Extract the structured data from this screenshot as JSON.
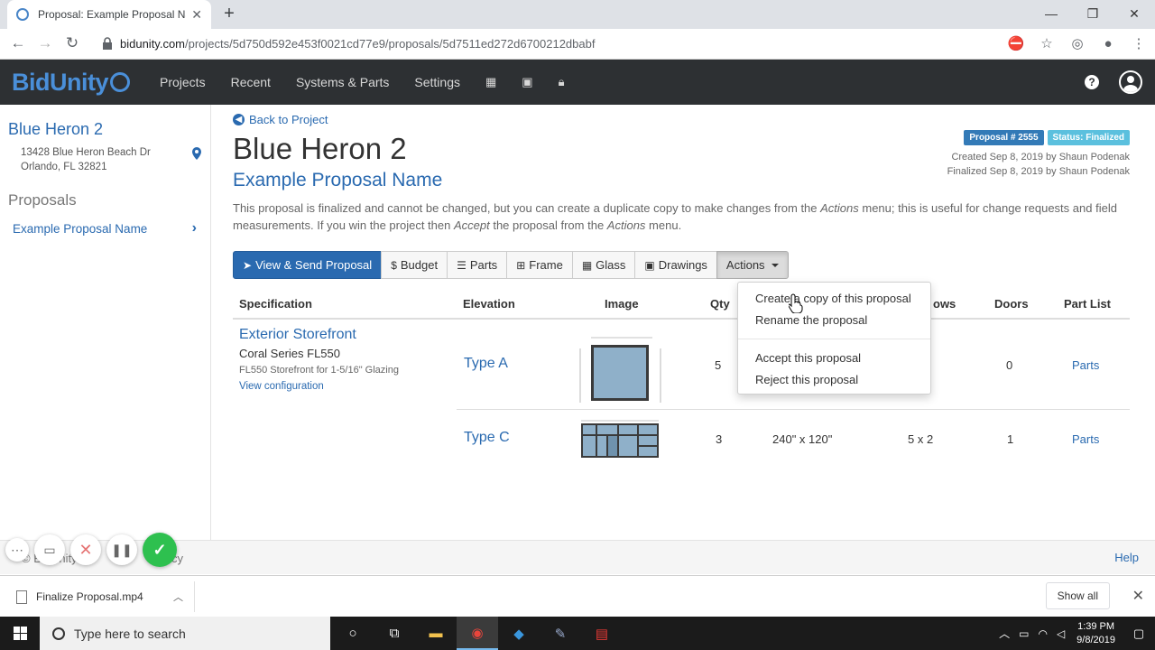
{
  "browser": {
    "tab_title": "Proposal: Example Proposal Nam",
    "url_host": "bidunity.com",
    "url_path": "/projects/5d750d592e453f0021cd77e9/proposals/5d7511ed272d6700212dbabf"
  },
  "navbar": {
    "logo": "BidUnity",
    "links": [
      "Projects",
      "Recent",
      "Systems & Parts",
      "Settings"
    ]
  },
  "sidebar": {
    "project_name": "Blue Heron 2",
    "address_line1": "13428 Blue Heron Beach Dr",
    "address_line2": "Orlando, FL 32821",
    "section_title": "Proposals",
    "active_proposal": "Example Proposal Name"
  },
  "main": {
    "back_link": "Back to Project",
    "title": "Blue Heron 2",
    "subtitle": "Example Proposal Name",
    "badge_number": "Proposal # 2555",
    "badge_status": "Status: Finalized",
    "created": "Created Sep 8, 2019 by Shaun Podenak",
    "finalized": "Finalized Sep 8, 2019 by Shaun Podenak",
    "info_1": "This proposal is finalized and cannot be changed, but you can create a duplicate copy to make changes from the ",
    "info_actions_1": "Actions",
    "info_2": " menu; this is useful for change requests and field measurements. If you win the project then ",
    "info_accept": "Accept",
    "info_3": " the proposal from the ",
    "info_actions_2": "Actions",
    "info_4": " menu."
  },
  "toolbar": {
    "view_send": "View & Send Proposal",
    "budget": "Budget",
    "parts": "Parts",
    "frame": "Frame",
    "glass": "Glass",
    "drawings": "Drawings",
    "actions": "Actions"
  },
  "table": {
    "headers": {
      "specification": "Specification",
      "elevation": "Elevation",
      "image": "Image",
      "qty": "Qty",
      "rows": "ows",
      "doors": "Doors",
      "part_list": "Part List"
    },
    "spec": {
      "title": "Exterior Storefront",
      "series": "Coral Series FL550",
      "desc": "FL550 Storefront for 1-5/16\" Glazing",
      "link": "View configuration"
    },
    "rows": [
      {
        "elevation": "Type A",
        "qty": "5",
        "size": "",
        "grid": "",
        "doors": "0",
        "part_list": "Parts"
      },
      {
        "elevation": "Type C",
        "qty": "3",
        "size": "240\" x 120\"",
        "grid": "5 x 2",
        "doors": "1",
        "part_list": "Parts"
      }
    ]
  },
  "actions_menu": {
    "items": [
      "Create a copy of this proposal",
      "Rename the proposal",
      "Accept this proposal",
      "Reject this proposal"
    ]
  },
  "footer": {
    "text": "© BidUnity",
    "policy_text": "cy",
    "help": "Help"
  },
  "downloads": {
    "file": "Finalize Proposal.mp4",
    "show_all": "Show all"
  },
  "taskbar": {
    "search_placeholder": "Type here to search",
    "time": "1:39 PM",
    "date": "9/8/2019"
  },
  "colors": {
    "brand": "#2a6ab0",
    "navbar": "#2d3033",
    "badge_number": "#337ab7",
    "badge_status": "#5bc0de"
  }
}
